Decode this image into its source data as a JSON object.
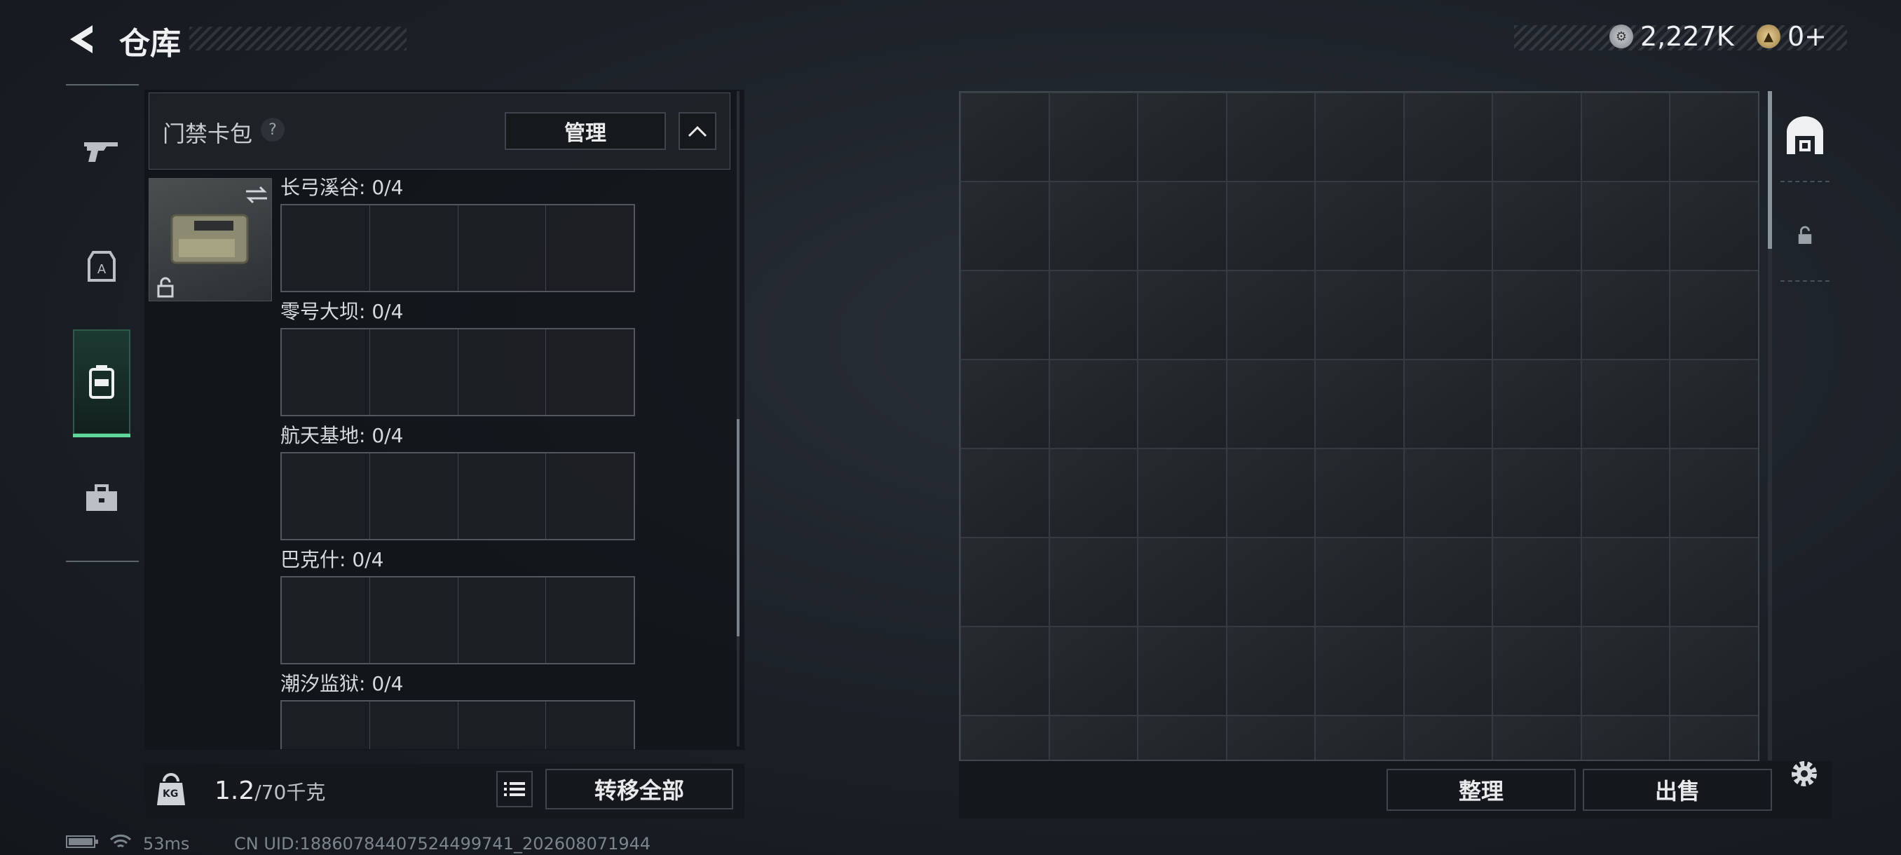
{
  "header": {
    "title": "仓库",
    "currency_1": "2,227K",
    "currency_2": "0+"
  },
  "left_rail": {
    "items": [
      "weapons",
      "character",
      "backpack",
      "toolbox"
    ],
    "active": "backpack"
  },
  "card_pack": {
    "title": "门禁卡包",
    "help": "?",
    "manage_label": "管理",
    "sections": [
      {
        "label": "长弓溪谷: 0/4",
        "slots": 4
      },
      {
        "label": "零号大坝: 0/4",
        "slots": 4
      },
      {
        "label": "航天基地: 0/4",
        "slots": 4
      },
      {
        "label": "巴克什: 0/4",
        "slots": 4
      },
      {
        "label": "潮汐监狱: 0/4",
        "slots": 4
      }
    ]
  },
  "footer_left": {
    "weight_value": "1.2",
    "weight_capacity": "/70千克",
    "kg_label": "KG",
    "transfer_all_label": "转移全部"
  },
  "storage_grid": {
    "columns": 9,
    "rows_visible": 8
  },
  "footer_right": {
    "organize_label": "整理",
    "sell_label": "出售"
  },
  "status_bar": {
    "ping": "53ms",
    "uid": "CN UID:1886078440752449974​1_202608071944"
  },
  "colors": {
    "accent_green": "#5fd69a",
    "panel_dark": "#0f1216"
  }
}
